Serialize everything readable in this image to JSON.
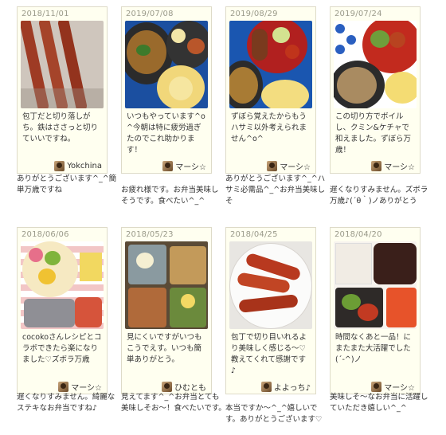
{
  "posts": [
    {
      "date": "2018/11/01",
      "caption": "包丁だと切り落しがち。鉄はささっと切りていいですね。",
      "user": "Yokchina",
      "reply": "ありがとうございます^_^簡単万歳ですね"
    },
    {
      "date": "2019/07/08",
      "caption": "いつもやっています^o^今朝は特に疲労過ぎたのでこれ助かります！",
      "user": "マーシ☆",
      "reply": "お疲れ様です。お弁当美味しそうです。食べたい^_^"
    },
    {
      "date": "2019/08/29",
      "caption": "ずぼら覚えたからもうハサミ以外考えられません^o^",
      "user": "マーシ☆",
      "reply": "ありがとうございます^_^ハサミ必需品^_^お弁当美味しそ"
    },
    {
      "date": "2019/07/24",
      "caption": "この切り方でボイルし、クミン&ケチャで和えました。ずぼら万歳！",
      "user": "マーシ☆",
      "reply": "遅くなりすみません。ズボラ万歳♪(´θ｀)ノありがとう"
    },
    {
      "date": "2018/06/06",
      "caption": "cocokoさんレシピとコラボできたら楽になりました♡ズボラ万歳",
      "user": "マーシ☆",
      "reply": "遅くなりすみません。綺麗なステキなお弁当ですね♪"
    },
    {
      "date": "2018/05/23",
      "caption": "見にくいですがいつもこうでえす。いつも簡単ありがとう。",
      "user": "ひむとも",
      "reply": "見えてます^_^お弁当とても美味しそお〜！食べたいです。"
    },
    {
      "date": "2018/04/25",
      "caption": "包丁で切り目いれるより美味しく感じる〜♡教えてくれて感謝です♪",
      "user": "よよっち♪",
      "reply": "本当ですか〜^_^嬉しいです。ありがとうございます♡"
    },
    {
      "date": "2018/04/20",
      "caption": "時間なくあと一品！にまたまた大活躍でした(´-^)ノ",
      "user": "マーシ☆",
      "reply": "美味しそ〜なお弁当に活躍していただき嬉しい^_^"
    }
  ]
}
